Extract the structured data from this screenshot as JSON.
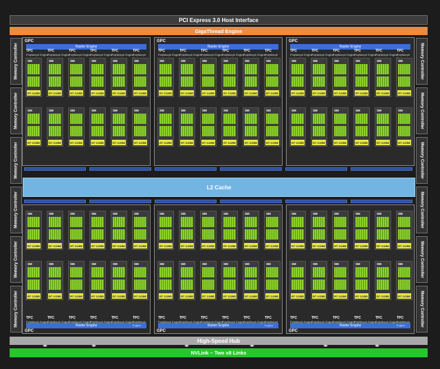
{
  "top": {
    "pcie": "PCI Express 3.0 Host Interface",
    "gigathread": "GigaThread Engine"
  },
  "middle": {
    "l2": "L2 Cache"
  },
  "bottom": {
    "hub": "High-Speed Hub",
    "nvlink": "NVLink – Two x8 Links"
  },
  "labels": {
    "memory_controller": "Memory Controller",
    "gpc": "GPC",
    "raster_engine": "Raster Engine",
    "tpc": "TPC",
    "polymorph_engine": "PolyMorph Engine",
    "sm": "SM",
    "rt_core": "RT CORE"
  },
  "colors": {
    "background": "#1c1c1c",
    "gigathread": "#f08a3c",
    "nvlink": "#27c72b",
    "l2_cache": "#73b5e2",
    "raster_engine": "#3a6fd8",
    "rt_core": "#e8e84a",
    "cuda_cores": "#6fb321"
  }
}
